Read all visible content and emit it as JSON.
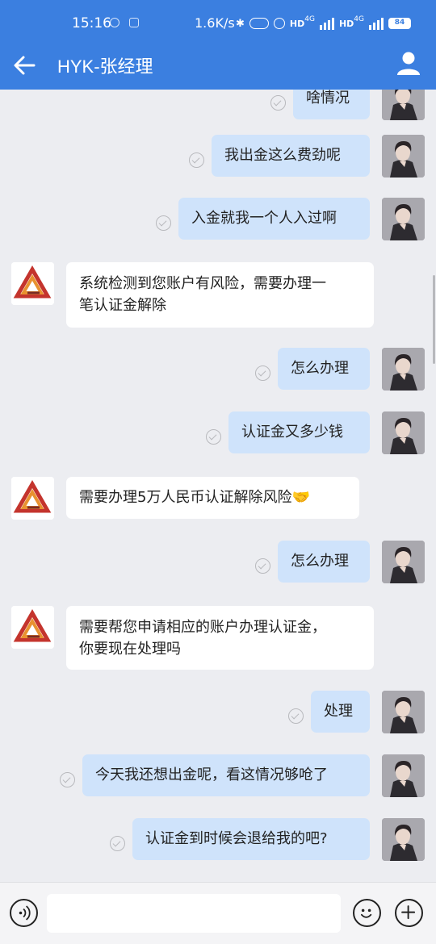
{
  "status_bar": {
    "time": "15:16",
    "net_speed": "1.6K/s",
    "signal_1": "HD",
    "signal_1_type": "4G",
    "signal_2": "HD",
    "signal_2_type": "4G",
    "battery": "84"
  },
  "header": {
    "title": "HYK-张经理",
    "back_icon": "arrow-left-icon",
    "profile_icon": "person-icon"
  },
  "messages": [
    {
      "side": "out",
      "text": "啥情况"
    },
    {
      "side": "out",
      "text": "我出金这么费劲呢"
    },
    {
      "side": "out",
      "text": "入金就我一个人入过啊"
    },
    {
      "side": "in",
      "lines": [
        "系统检测到您账户有风险，需要办理一",
        "笔认证金解除"
      ]
    },
    {
      "side": "out",
      "text": "怎么办理"
    },
    {
      "side": "out",
      "text": "认证金又多少钱"
    },
    {
      "side": "in",
      "lines": [
        "需要办理5万人民币认证解除风险🤝"
      ]
    },
    {
      "side": "out",
      "text": "怎么办理"
    },
    {
      "side": "in",
      "lines": [
        "需要帮您申请相应的账户办理认证金，",
        "你要现在处理吗"
      ]
    },
    {
      "side": "out",
      "text": "处理"
    },
    {
      "side": "out",
      "text": "今天我还想出金呢，看这情况够呛了"
    },
    {
      "side": "out",
      "text": "认证金到时候会退给我的吧?"
    }
  ],
  "input_bar": {
    "voice_icon": "voice-icon",
    "input_value": "",
    "emoji_icon": "emoji-icon",
    "plus_icon": "plus-icon"
  }
}
